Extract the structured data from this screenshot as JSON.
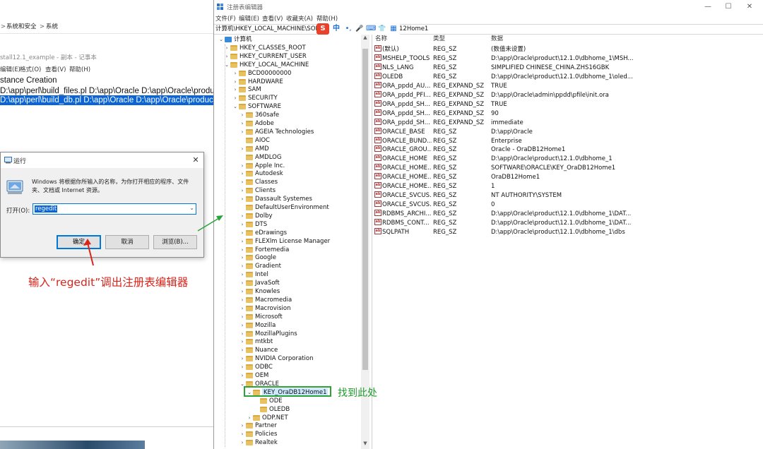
{
  "background_window": {
    "breadcrumb": [
      "系统和安全",
      "系统"
    ],
    "breadcrumb_sep": ">",
    "notepad_title": "stall12.1_example - 副本 - 记事本",
    "notepad_menu": [
      "编辑(E)",
      "格式(O)",
      "查看(V)",
      "帮助(H)"
    ],
    "lines": [
      "stance Creation",
      "D:\\app\\perl\\build_files.pl D:\\app\\Oracle D:\\app\\Oracle\\product\\12.1.0\\dbhome_1",
      "D:\\app\\perl\\build_db.pl D:\\app\\Oracle D:\\app\\Oracle\\product\\12.1.0\\dbhome_1"
    ]
  },
  "run_dialog": {
    "title": "运行",
    "close_glyph": "✕",
    "description": "Windows 将根据你所输入的名称，为你打开相应的程序、文件夹、文档或 Internet 资源。",
    "open_label": "打开(O):",
    "input_value": "regedit",
    "dropdown_glyph": "⌄",
    "buttons": {
      "ok": "确定",
      "cancel": "取消",
      "browse": "浏览(B)..."
    }
  },
  "annotations": {
    "regedit_hint": "输入“regedit”调出注册表编辑器",
    "found_hint": "找到此处",
    "colors": {
      "red": "#d9251c",
      "green": "#2aa43a"
    }
  },
  "regedit": {
    "title": "注册表编辑器",
    "window_controls": {
      "minimize": "—",
      "maximize": "☐",
      "close": "✕"
    },
    "menu": [
      "文件(F)",
      "编辑(E)",
      "查看(V)",
      "收藏夹(A)",
      "帮助(H)"
    ],
    "address_left": "计算机\\HKEY_LOCAL_MACHINE\\SOF",
    "address_right": "12Home1",
    "ime": {
      "s": "S",
      "zh": "中",
      "punct": "•,",
      "mic": "🎤",
      "kbd": "⌨",
      "shirt": "👕",
      "grid": "▦"
    },
    "tree": [
      {
        "label": "计算机",
        "level": 0,
        "expanded": true,
        "icon": "computer"
      },
      {
        "label": "HKEY_CLASSES_ROOT",
        "level": 1,
        "expanded": false
      },
      {
        "label": "HKEY_CURRENT_USER",
        "level": 1,
        "expanded": false
      },
      {
        "label": "HKEY_LOCAL_MACHINE",
        "level": 1,
        "expanded": true
      },
      {
        "label": "BCD00000000",
        "level": 2,
        "expanded": false
      },
      {
        "label": "HARDWARE",
        "level": 2,
        "expanded": false
      },
      {
        "label": "SAM",
        "level": 2,
        "expanded": false
      },
      {
        "label": "SECURITY",
        "level": 2,
        "expanded": false
      },
      {
        "label": "SOFTWARE",
        "level": 2,
        "expanded": true
      },
      {
        "label": "360safe",
        "level": 3,
        "expanded": false
      },
      {
        "label": "Adobe",
        "level": 3,
        "expanded": false
      },
      {
        "label": "AGEIA Technologies",
        "level": 3,
        "expanded": false
      },
      {
        "label": "AIOC",
        "level": 3,
        "leaf": true
      },
      {
        "label": "AMD",
        "level": 3,
        "expanded": false
      },
      {
        "label": "AMDLOG",
        "level": 3,
        "leaf": true
      },
      {
        "label": "Apple Inc.",
        "level": 3,
        "expanded": false
      },
      {
        "label": "Autodesk",
        "level": 3,
        "expanded": false
      },
      {
        "label": "Classes",
        "level": 3,
        "expanded": false
      },
      {
        "label": "Clients",
        "level": 3,
        "expanded": false
      },
      {
        "label": "Dassault Systemes",
        "level": 3,
        "expanded": false
      },
      {
        "label": "DefaultUserEnvironment",
        "level": 3,
        "leaf": true
      },
      {
        "label": "Dolby",
        "level": 3,
        "expanded": false
      },
      {
        "label": "DTS",
        "level": 3,
        "expanded": false
      },
      {
        "label": "eDrawings",
        "level": 3,
        "expanded": false
      },
      {
        "label": "FLEXlm License Manager",
        "level": 3,
        "expanded": false
      },
      {
        "label": "Fortemedia",
        "level": 3,
        "expanded": false
      },
      {
        "label": "Google",
        "level": 3,
        "expanded": false
      },
      {
        "label": "Gradient",
        "level": 3,
        "expanded": false
      },
      {
        "label": "Intel",
        "level": 3,
        "expanded": false
      },
      {
        "label": "JavaSoft",
        "level": 3,
        "expanded": false
      },
      {
        "label": "Knowles",
        "level": 3,
        "expanded": false
      },
      {
        "label": "Macromedia",
        "level": 3,
        "expanded": false
      },
      {
        "label": "Macrovision",
        "level": 3,
        "expanded": false
      },
      {
        "label": "Microsoft",
        "level": 3,
        "expanded": false
      },
      {
        "label": "Mozilla",
        "level": 3,
        "expanded": false
      },
      {
        "label": "MozillaPlugins",
        "level": 3,
        "expanded": false
      },
      {
        "label": "mtkbt",
        "level": 3,
        "expanded": false
      },
      {
        "label": "Nuance",
        "level": 3,
        "expanded": false
      },
      {
        "label": "NVIDIA Corporation",
        "level": 3,
        "expanded": false
      },
      {
        "label": "ODBC",
        "level": 3,
        "expanded": false
      },
      {
        "label": "OEM",
        "level": 3,
        "expanded": false
      },
      {
        "label": "ORACLE",
        "level": 3,
        "expanded": true
      },
      {
        "label": "KEY_OraDB12Home1",
        "level": 4,
        "expanded": true,
        "selected": true
      },
      {
        "label": "ODE",
        "level": 5,
        "leaf": true
      },
      {
        "label": "OLEDB",
        "level": 5,
        "leaf": true
      },
      {
        "label": "ODP.NET",
        "level": 4,
        "expanded": false
      },
      {
        "label": "Partner",
        "level": 3,
        "expanded": false
      },
      {
        "label": "Policies",
        "level": 3,
        "expanded": false
      },
      {
        "label": "Realtek",
        "level": 3,
        "expanded": false
      }
    ],
    "columns": {
      "name": "名称",
      "type": "类型",
      "data": "数据"
    },
    "values": [
      {
        "name": "(默认)",
        "type": "REG_SZ",
        "data": "(数值未设置)"
      },
      {
        "name": "MSHELP_TOOLS",
        "type": "REG_SZ",
        "data": "D:\\app\\Oracle\\product\\12.1.0\\dbhome_1\\MSH..."
      },
      {
        "name": "NLS_LANG",
        "type": "REG_SZ",
        "data": "SIMPLIFIED CHINESE_CHINA.ZHS16GBK"
      },
      {
        "name": "OLEDB",
        "type": "REG_SZ",
        "data": "D:\\app\\Oracle\\product\\12.1.0\\dbhome_1\\oled..."
      },
      {
        "name": "ORA_ppdd_AU...",
        "type": "REG_EXPAND_SZ",
        "data": "TRUE"
      },
      {
        "name": "ORA_ppdd_PFI...",
        "type": "REG_EXPAND_SZ",
        "data": "D:\\app\\Oracle\\admin\\ppdd\\pfile\\init.ora"
      },
      {
        "name": "ORA_ppdd_SH...",
        "type": "REG_EXPAND_SZ",
        "data": "TRUE"
      },
      {
        "name": "ORA_ppdd_SH...",
        "type": "REG_EXPAND_SZ",
        "data": "90"
      },
      {
        "name": "ORA_ppdd_SH...",
        "type": "REG_EXPAND_SZ",
        "data": "immediate"
      },
      {
        "name": "ORACLE_BASE",
        "type": "REG_SZ",
        "data": "D:\\app\\Oracle"
      },
      {
        "name": "ORACLE_BUND...",
        "type": "REG_SZ",
        "data": "Enterprise"
      },
      {
        "name": "ORACLE_GROU...",
        "type": "REG_SZ",
        "data": "Oracle - OraDB12Home1"
      },
      {
        "name": "ORACLE_HOME",
        "type": "REG_SZ",
        "data": "D:\\app\\Oracle\\product\\12.1.0\\dbhome_1"
      },
      {
        "name": "ORACLE_HOME...",
        "type": "REG_SZ",
        "data": "SOFTWARE\\ORACLE\\KEY_OraDB12Home1"
      },
      {
        "name": "ORACLE_HOME...",
        "type": "REG_SZ",
        "data": "OraDB12Home1"
      },
      {
        "name": "ORACLE_HOME...",
        "type": "REG_SZ",
        "data": "1"
      },
      {
        "name": "ORACLE_SVCUS...",
        "type": "REG_SZ",
        "data": "NT AUTHORITY\\SYSTEM"
      },
      {
        "name": "ORACLE_SVCUS...",
        "type": "REG_SZ",
        "data": "0"
      },
      {
        "name": "RDBMS_ARCHI...",
        "type": "REG_SZ",
        "data": "D:\\app\\Oracle\\product\\12.1.0\\dbhome_1\\DAT..."
      },
      {
        "name": "RDBMS_CONT...",
        "type": "REG_SZ",
        "data": "D:\\app\\Oracle\\product\\12.1.0\\dbhome_1\\DAT..."
      },
      {
        "name": "SQLPATH",
        "type": "REG_SZ",
        "data": "D:\\app\\Oracle\\product\\12.1.0\\dbhome_1\\dbs"
      }
    ],
    "value_icon_text": "ab"
  }
}
